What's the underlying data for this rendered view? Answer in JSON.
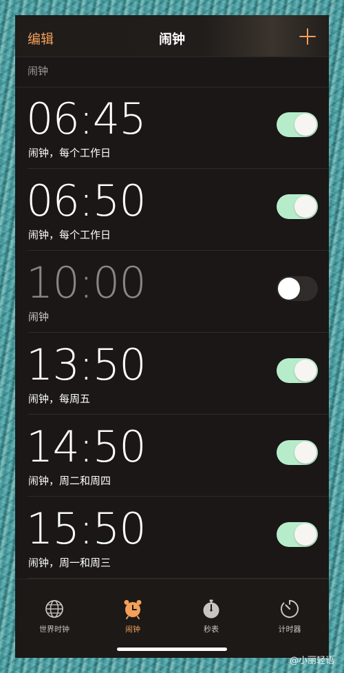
{
  "nav": {
    "edit_label": "编辑",
    "title": "闹钟",
    "add_icon": "plus-icon"
  },
  "section_header": "闹钟",
  "alarms": [
    {
      "time": "06:45",
      "label": "闹钟，每个工作日",
      "enabled": true
    },
    {
      "time": "06:50",
      "label": "闹钟，每个工作日",
      "enabled": true
    },
    {
      "time": "10:00",
      "label": "闹钟",
      "enabled": false
    },
    {
      "time": "13:50",
      "label": "闹钟，每周五",
      "enabled": true
    },
    {
      "time": "14:50",
      "label": "闹钟，周二和周四",
      "enabled": true
    },
    {
      "time": "15:50",
      "label": "闹钟，周一和周三",
      "enabled": true
    }
  ],
  "tabs": [
    {
      "label": "世界时钟",
      "icon": "globe-icon",
      "active": false
    },
    {
      "label": "闹钟",
      "icon": "alarm-clock-icon",
      "active": true
    },
    {
      "label": "秒表",
      "icon": "stopwatch-icon",
      "active": false
    },
    {
      "label": "计时器",
      "icon": "timer-icon",
      "active": false
    }
  ],
  "watermark": "@小丽轻语",
  "colors": {
    "accent": "#f2a05a",
    "toggle_on": "#b7eccb",
    "toggle_off": "#2f2c2a",
    "background": "#1a1716"
  }
}
